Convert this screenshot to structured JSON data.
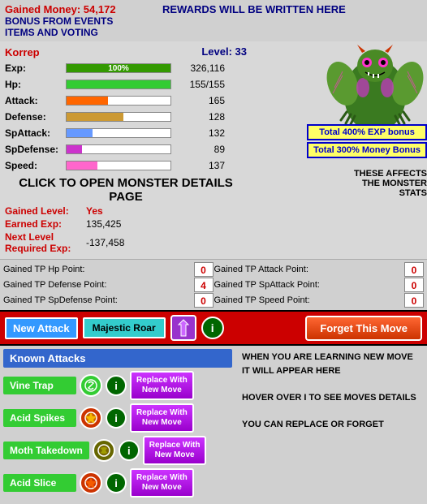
{
  "header": {
    "gained_money_label": "Gained Money: 54,172",
    "rewards_label": "REWARDS WILL BE WRITTEN HERE",
    "bonus_events_label": "BONUS FROM EVENTS",
    "items_voting_label": "ITEMS AND VOTING"
  },
  "player": {
    "name": "Korrep",
    "level_label": "Level: 33",
    "exp_label": "Exp:",
    "exp_bar_pct": 100,
    "exp_value": "326,116",
    "hp_label": "Hp:",
    "hp_bar_pct": 100,
    "hp_value": "155/155",
    "attack_label": "Attack:",
    "attack_bar_pct": 40,
    "attack_value": "165",
    "defense_label": "Defense:",
    "defense_bar_pct": 55,
    "defense_value": "128",
    "spattack_label": "SpAttack:",
    "spattack_bar_pct": 25,
    "spattack_value": "132",
    "spdefense_label": "SpDefense:",
    "spdefense_bar_pct": 15,
    "spdefense_value": "89",
    "speed_label": "Speed:",
    "speed_bar_pct": 30,
    "speed_value": "137",
    "click_to_open": "CLICK TO OPEN MONSTER DETAILS PAGE",
    "gained_level_label": "Gained Level:",
    "gained_level_value": "Yes",
    "earned_exp_label": "Earned Exp:",
    "earned_exp_value": "135,425",
    "next_level_label": "Next Level Required Exp:",
    "next_level_value": "-137,458"
  },
  "bonuses": {
    "exp_bonus": "Total 400% EXP bonus",
    "money_bonus": "Total 300% Money Bonus",
    "these_affects": "THESE AFFECTS THE MONSTER STATS"
  },
  "tp_points": {
    "hp_label": "Gained TP Hp Point:",
    "hp_value": "0",
    "attack_label": "Gained TP Attack Point:",
    "attack_value": "0",
    "defense_label": "Gained TP Defense Point:",
    "defense_value": "4",
    "spattack_label": "Gained TP SpAttack Point:",
    "spattack_value": "0",
    "spdefense_label": "Gained TP SpDefense Point:",
    "spdefense_value": "0",
    "speed_label": "Gained TP Speed Point:",
    "speed_value": "0"
  },
  "attack_bar": {
    "new_attack_label": "New Attack",
    "majestic_roar_label": "Majestic Roar",
    "forget_label": "Forget This Move"
  },
  "known_attacks": {
    "section_label": "Known Attacks",
    "attacks": [
      {
        "name": "Vine Trap",
        "replace_line1": "Replace With",
        "replace_line2": "New Move"
      },
      {
        "name": "Acid Spikes",
        "replace_line1": "Replace With",
        "replace_line2": "New Move"
      },
      {
        "name": "Moth Takedown",
        "replace_line1": "Replace With",
        "replace_line2": "New Move"
      },
      {
        "name": "Acid Slice",
        "replace_line1": "Replace With",
        "replace_line2": "New Move"
      }
    ],
    "hint_text": "WHEN YOU ARE LEARNING NEW MOVE IT WILL APPEAR HERE\n\nHOVER OVER I TO SEE MOVES DETAILS\n\nYOU CAN REPLACE OR FORGET"
  }
}
